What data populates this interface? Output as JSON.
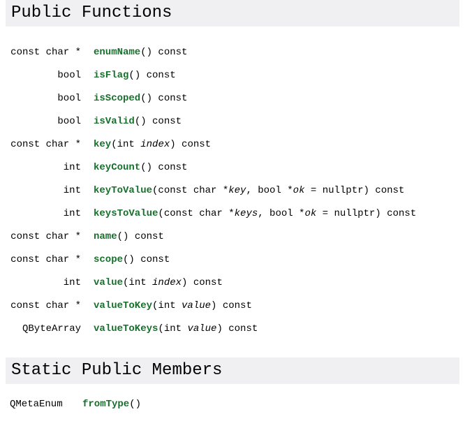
{
  "colors": {
    "page_background": "#ffffff",
    "heading_band": "#f0f0f2",
    "link_green": "#17702c",
    "text": "#000000"
  },
  "sections": [
    {
      "id": "public-functions",
      "heading": "Public Functions",
      "rows": [
        {
          "return_type": "const char *",
          "name": "enumName",
          "signature_rest": "() const"
        },
        {
          "return_type": "bool",
          "name": "isFlag",
          "signature_rest": "() const"
        },
        {
          "return_type": "bool",
          "name": "isScoped",
          "signature_rest": "() const"
        },
        {
          "return_type": "bool",
          "name": "isValid",
          "signature_rest": "() const"
        },
        {
          "return_type": "const char *",
          "name": "key",
          "signature_rest": "(int index) const",
          "parts": [
            {
              "t": "(int ",
              "i": false
            },
            {
              "t": "index",
              "i": true
            },
            {
              "t": ") const",
              "i": false
            }
          ]
        },
        {
          "return_type": "int",
          "name": "keyCount",
          "signature_rest": "() const"
        },
        {
          "return_type": "int",
          "name": "keyToValue",
          "signature_rest": "(const char *key, bool *ok = nullptr) const",
          "parts": [
            {
              "t": "(const char *",
              "i": false
            },
            {
              "t": "key",
              "i": true
            },
            {
              "t": ", bool *",
              "i": false
            },
            {
              "t": "ok",
              "i": true
            },
            {
              "t": " = nullptr) const",
              "i": false
            }
          ]
        },
        {
          "return_type": "int",
          "name": "keysToValue",
          "signature_rest": "(const char *keys, bool *ok = nullptr) const",
          "parts": [
            {
              "t": "(const char *",
              "i": false
            },
            {
              "t": "keys",
              "i": true
            },
            {
              "t": ", bool *",
              "i": false
            },
            {
              "t": "ok",
              "i": true
            },
            {
              "t": " = nullptr) const",
              "i": false
            }
          ]
        },
        {
          "return_type": "const char *",
          "name": "name",
          "signature_rest": "() const"
        },
        {
          "return_type": "const char *",
          "name": "scope",
          "signature_rest": "() const"
        },
        {
          "return_type": "int",
          "name": "value",
          "signature_rest": "(int index) const",
          "parts": [
            {
              "t": "(int ",
              "i": false
            },
            {
              "t": "index",
              "i": true
            },
            {
              "t": ") const",
              "i": false
            }
          ]
        },
        {
          "return_type": "const char *",
          "name": "valueToKey",
          "signature_rest": "(int value) const",
          "parts": [
            {
              "t": "(int ",
              "i": false
            },
            {
              "t": "value",
              "i": true
            },
            {
              "t": ") const",
              "i": false
            }
          ]
        },
        {
          "return_type": "QByteArray",
          "name": "valueToKeys",
          "signature_rest": "(int value) const",
          "parts": [
            {
              "t": "(int ",
              "i": false
            },
            {
              "t": "value",
              "i": true
            },
            {
              "t": ") const",
              "i": false
            }
          ]
        }
      ]
    },
    {
      "id": "static-public-members",
      "heading": "Static Public Members",
      "rows": [
        {
          "return_type": "QMetaEnum",
          "name": "fromType",
          "signature_rest": "()"
        }
      ]
    }
  ]
}
